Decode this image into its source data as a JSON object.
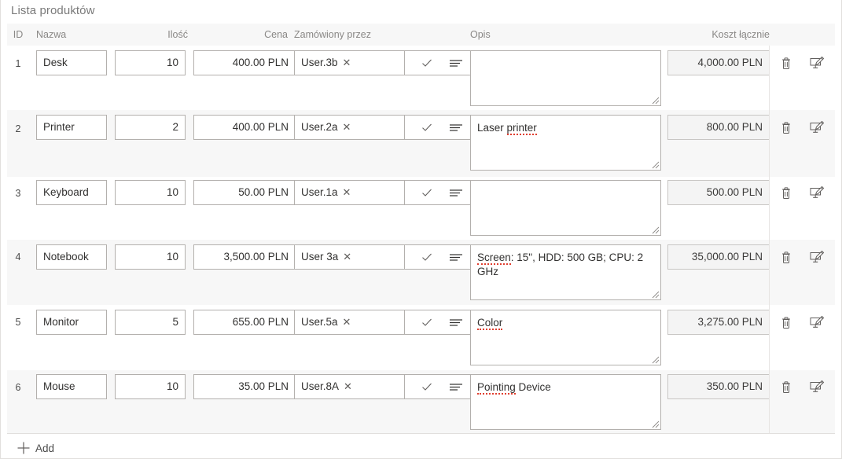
{
  "panel": {
    "title": "Lista produktów"
  },
  "columns": {
    "id": "ID",
    "name": "Nazwa",
    "quantity": "Ilość",
    "price": "Cena",
    "ordered_by": "Zamówiony przez",
    "description": "Opis",
    "total_cost": "Koszt łącznie"
  },
  "icons": {
    "picker_confirm": "checkmark-icon",
    "picker_list": "list-lines-icon",
    "delete": "trash-icon",
    "edit": "edit-screen-icon",
    "token_remove": "close-x-icon",
    "add": "plus-icon",
    "resize": "resize-grip-icon"
  },
  "footer": {
    "add_label": "Add"
  },
  "rows": [
    {
      "id": "1",
      "name": "Desk",
      "quantity": "10",
      "price": "400.00 PLN",
      "ordered_by": "User.3b",
      "description": "",
      "description_misspelled": "",
      "description_rest": "",
      "total_cost": "4,000.00 PLN"
    },
    {
      "id": "2",
      "name": "Printer",
      "quantity": "2",
      "price": "400.00 PLN",
      "ordered_by": "User.2a",
      "description": "Laser printer",
      "description_misspelled": "printer",
      "description_rest": "Laser ",
      "total_cost": "800.00 PLN"
    },
    {
      "id": "3",
      "name": "Keyboard",
      "quantity": "10",
      "price": "50.00 PLN",
      "ordered_by": "User.1a",
      "description": "",
      "description_misspelled": "",
      "description_rest": "",
      "total_cost": "500.00 PLN"
    },
    {
      "id": "4",
      "name": "Notebook",
      "quantity": "10",
      "price": "3,500.00 PLN",
      "ordered_by": "User 3a",
      "description": "Screen: 15\", HDD: 500 GB; CPU: 2 GHz",
      "description_misspelled": "Screen",
      "description_rest": ": 15\", HDD: 500 GB; CPU: 2 GHz",
      "total_cost": "35,000.00 PLN"
    },
    {
      "id": "5",
      "name": "Monitor",
      "quantity": "5",
      "price": "655.00 PLN",
      "ordered_by": "User.5a",
      "description": "Color",
      "description_misspelled": "Color",
      "description_rest": "",
      "total_cost": "3,275.00 PLN"
    },
    {
      "id": "6",
      "name": "Mouse",
      "quantity": "10",
      "price": "35.00 PLN",
      "ordered_by": "User.8A",
      "description": "Pointing Device",
      "description_misspelled": "Pointing",
      "description_rest": " Device",
      "total_cost": "350.00 PLN"
    }
  ],
  "colors": {
    "header_bg": "#f7f7f7",
    "alt_row_bg": "#f7f7f7",
    "border": "#b3b0ad",
    "readonly_bg": "#f4f4f4",
    "text": "#323130",
    "muted_text": "#8a8886",
    "spellcheck": "#e03e2f"
  }
}
